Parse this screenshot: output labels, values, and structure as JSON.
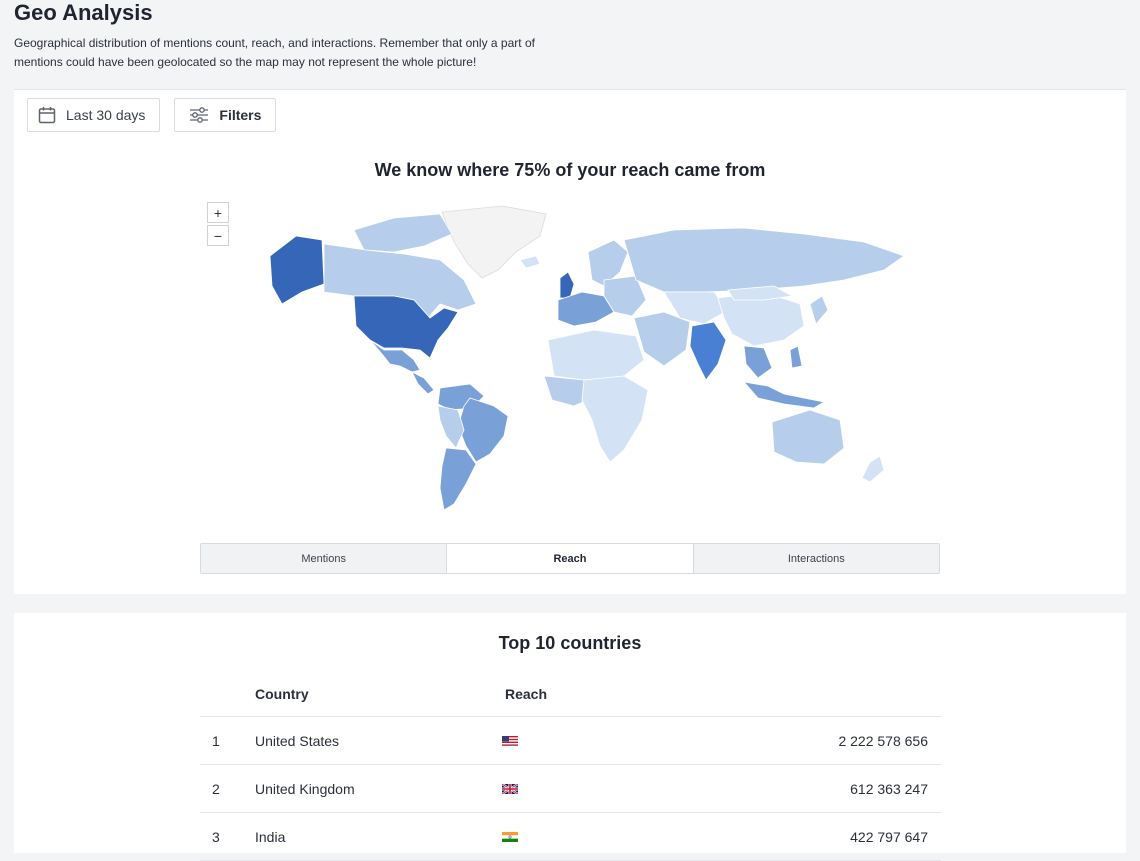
{
  "header": {
    "title": "Geo Analysis",
    "description": "Geographical distribution of mentions count, reach, and interactions. Remember that only a part of mentions could have been geolocated so the map may not represent the whole picture!"
  },
  "toolbar": {
    "date_label": "Last 30 days",
    "filters_label": "Filters"
  },
  "map": {
    "title": "We know where 75% of your reach came from",
    "zoom_in": "+",
    "zoom_out": "−",
    "colors": {
      "max": "#3566b8",
      "high": "#4a80d4",
      "mid": "#7aa0d8",
      "low": "#b7cdec",
      "lowest": "#d4e2f5",
      "none": "#f3f3f3"
    }
  },
  "metric_tabs": {
    "items": [
      {
        "label": "Mentions",
        "active": false
      },
      {
        "label": "Reach",
        "active": true
      },
      {
        "label": "Interactions",
        "active": false
      }
    ]
  },
  "top_countries": {
    "title": "Top 10 countries",
    "col_country": "Country",
    "col_reach": "Reach",
    "rows": [
      {
        "rank": "1",
        "country": "United States",
        "flag": "us-flag-icon",
        "reach": "2 222 578 656"
      },
      {
        "rank": "2",
        "country": "United Kingdom",
        "flag": "uk-flag-icon",
        "reach": "612 363 247"
      },
      {
        "rank": "3",
        "country": "India",
        "flag": "india-flag-icon",
        "reach": "422 797 647"
      }
    ]
  }
}
